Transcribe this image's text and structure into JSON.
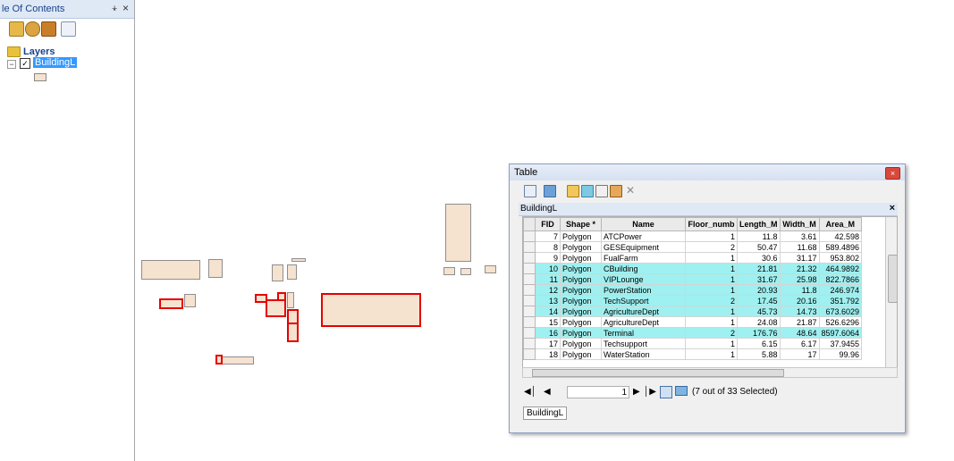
{
  "toc": {
    "title": "le Of Contents",
    "pin_glyph": "&#x1F4CC;",
    "close_glyph": "×",
    "layers_label": "Layers",
    "layer_name": "BuildingL",
    "expander": "−",
    "check": "✓"
  },
  "table_window": {
    "title": "Table",
    "close_glyph": "×",
    "tab_title": "BuildingL",
    "tab_close": "×",
    "columns": [
      "FID",
      "Shape *",
      "Name",
      "Floor_numb",
      "Length_M",
      "Width_M",
      "Area_M"
    ],
    "rows": [
      {
        "fid": "7",
        "shape": "Polygon",
        "name": "ATCPower",
        "floor": "1",
        "length": "11.8",
        "width": "3.61",
        "area": "42.598",
        "highlight": false
      },
      {
        "fid": "8",
        "shape": "Polygon",
        "name": "GESEquipment",
        "floor": "2",
        "length": "50.47",
        "width": "11.68",
        "area": "589.4896",
        "highlight": false
      },
      {
        "fid": "9",
        "shape": "Polygon",
        "name": "FualFarm",
        "floor": "1",
        "length": "30.6",
        "width": "31.17",
        "area": "953.802",
        "highlight": false
      },
      {
        "fid": "10",
        "shape": "Polygon",
        "name": "CBuilding",
        "floor": "1",
        "length": "21.81",
        "width": "21.32",
        "area": "464.9892",
        "highlight": true
      },
      {
        "fid": "11",
        "shape": "Polygon",
        "name": "VIPLounge",
        "floor": "1",
        "length": "31.67",
        "width": "25.98",
        "area": "822.7866",
        "highlight": true
      },
      {
        "fid": "12",
        "shape": "Polygon",
        "name": "PowerStation",
        "floor": "1",
        "length": "20.93",
        "width": "11.8",
        "area": "246.974",
        "highlight": true
      },
      {
        "fid": "13",
        "shape": "Polygon",
        "name": "TechSupport",
        "floor": "2",
        "length": "17.45",
        "width": "20.16",
        "area": "351.792",
        "highlight": true
      },
      {
        "fid": "14",
        "shape": "Polygon",
        "name": " AgricultureDept",
        "floor": "1",
        "length": "45.73",
        "width": "14.73",
        "area": "673.6029",
        "highlight": true
      },
      {
        "fid": "15",
        "shape": "Polygon",
        "name": "AgricultureDept",
        "floor": "1",
        "length": "24.08",
        "width": "21.87",
        "area": "526.6296",
        "highlight": false
      },
      {
        "fid": "16",
        "shape": "Polygon",
        "name": "Terminal",
        "floor": "2",
        "length": "176.76",
        "width": "48.64",
        "area": "8597.6064",
        "highlight": true
      },
      {
        "fid": "17",
        "shape": "Polygon",
        "name": "Techsupport",
        "floor": "1",
        "length": "6.15",
        "width": "6.17",
        "area": "37.9455",
        "highlight": false
      },
      {
        "fid": "18",
        "shape": "Polygon",
        "name": "WaterStation",
        "floor": "1",
        "length": "5.88",
        "width": "17",
        "area": "99.96",
        "highlight": false
      }
    ],
    "nav": {
      "first": "◀│",
      "prev": "◀",
      "record": "1",
      "next": "▶",
      "last": "│▶"
    },
    "selection_info": "(7 out of 33 Selected)",
    "bottom_tab": "BuildingL"
  }
}
